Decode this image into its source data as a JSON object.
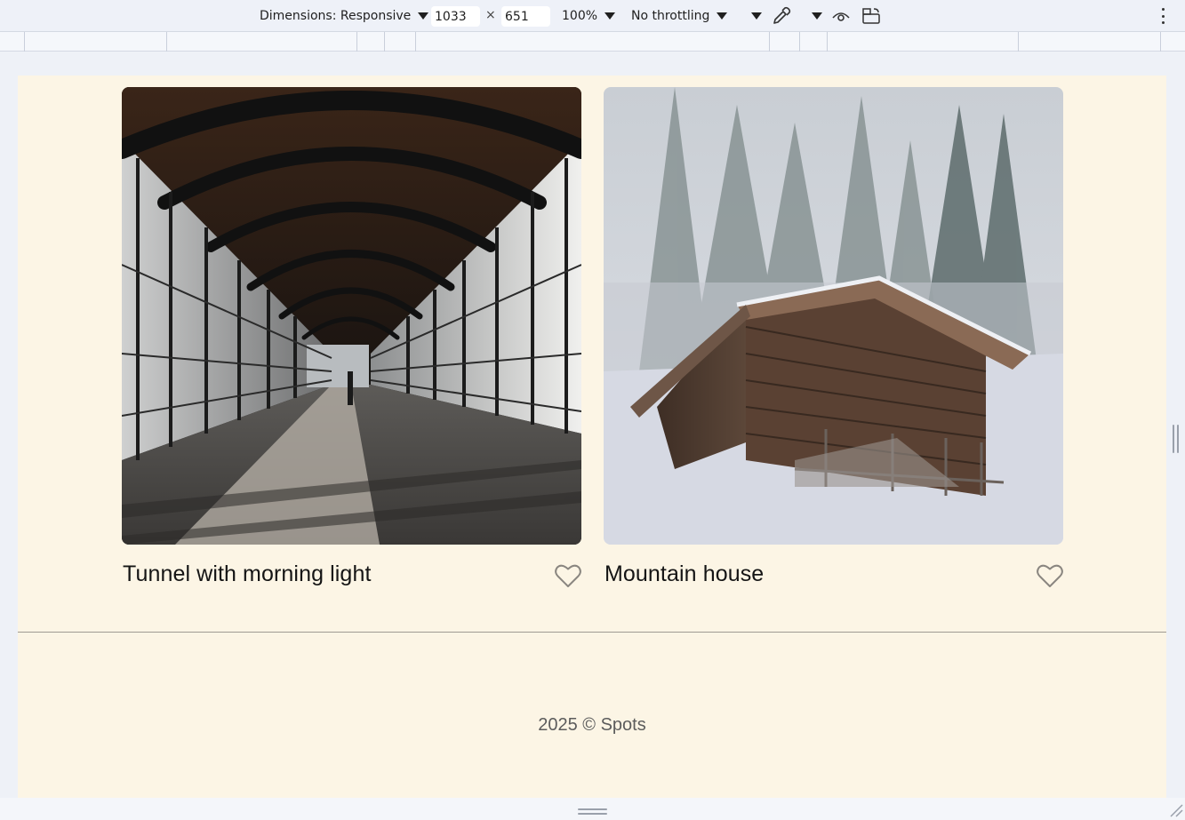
{
  "devtools": {
    "dimensions_label": "Dimensions: Responsive",
    "width_value": "1033",
    "times": "×",
    "height_value": "651",
    "zoom_label": "100%",
    "throttling_label": "No throttling",
    "icons": [
      "chevron-down-icon",
      "eyedropper-icon",
      "eye-icon",
      "device-rotate-icon",
      "more-vert-icon"
    ]
  },
  "page": {
    "cards": [
      {
        "title": "Tunnel with morning light",
        "image": "tunnel-photo",
        "liked": false
      },
      {
        "title": "Mountain house",
        "image": "mountain-house-photo",
        "liked": false
      }
    ],
    "footer": {
      "copyright": "2025 © Spots"
    }
  },
  "colors": {
    "page_background": "#fcf5e5",
    "title_text": "#151515",
    "footer_text": "#5c5c5c",
    "heart_outline": "#8a8680",
    "devtools_toolbar": "#eef1f8"
  }
}
